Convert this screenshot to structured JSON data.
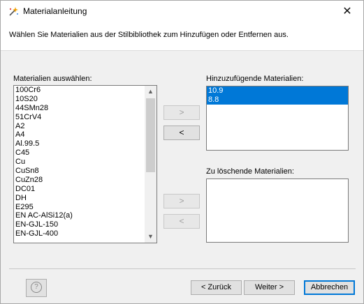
{
  "window": {
    "title": "Materialanleitung",
    "close_glyph": "✕"
  },
  "header": {
    "instruction": "Wählen Sie Materialien aus der Stilbibliothek zum Hinzufügen oder Entfernen aus."
  },
  "available": {
    "label": "Materialien auswählen:",
    "items": [
      "100Cr6",
      "10S20",
      "44SMn28",
      "51CrV4",
      "A2",
      "A4",
      "Al.99.5",
      "C45",
      "Cu",
      "CuSn8",
      "CuZn28",
      "DC01",
      "DH",
      "E295",
      "EN AC-AlSi12(a)",
      "EN-GJL-150",
      "EN-GJL-400"
    ]
  },
  "to_add": {
    "label": "Hinzuzufügende Materialien:",
    "items": [
      "10.9",
      "8.8"
    ]
  },
  "to_delete": {
    "label": "Zu löschende Materialien:",
    "items": []
  },
  "move_buttons": {
    "add_right": ">",
    "add_left": "<",
    "del_right": ">",
    "del_left": "<"
  },
  "footer": {
    "help": "?",
    "back": "< Zurück",
    "next": "Weiter >",
    "cancel": "Abbrechen"
  },
  "scroll": {
    "up_glyph": "▲",
    "down_glyph": "▼"
  }
}
